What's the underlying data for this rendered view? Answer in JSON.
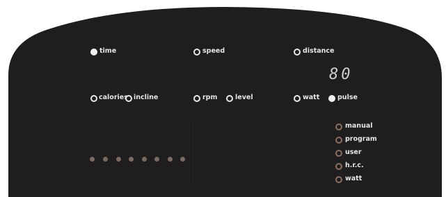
{
  "display": {
    "readout": "80",
    "colors": {
      "panel": "#1f1d1d",
      "text": "#e6e6e6",
      "program_indicator": "#8a6f63"
    }
  },
  "indicators": {
    "time": {
      "label": "time",
      "active": true
    },
    "speed": {
      "label": "speed",
      "active": false
    },
    "distance": {
      "label": "distance",
      "active": false
    },
    "calories": {
      "label": "calories",
      "active": false
    },
    "incline": {
      "label": "incline",
      "active": false
    },
    "rpm": {
      "label": "rpm",
      "active": false
    },
    "level": {
      "label": "level",
      "active": false
    },
    "watt": {
      "label": "watt",
      "active": false
    },
    "pulse": {
      "label": "pulse",
      "active": true
    }
  },
  "programs": {
    "manual": "manual",
    "program": "program",
    "user": "user",
    "hrc": "h.r.c.",
    "watt": "watt"
  },
  "level_dots_count": 8
}
